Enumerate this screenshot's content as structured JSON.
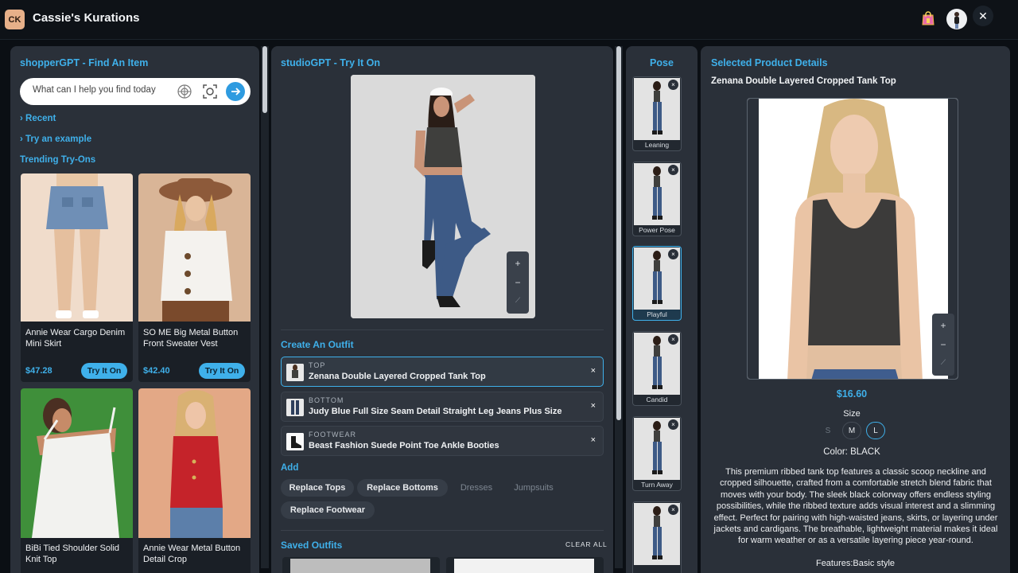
{
  "app": {
    "logo": "CK",
    "title": "Cassie's Kurations",
    "close": "✕"
  },
  "shopper": {
    "title": "shopperGPT - Find An Item",
    "search_placeholder": "What can I help you find today",
    "recent": "Recent",
    "example": "Try an example",
    "trending": "Trending Try-Ons",
    "products": [
      {
        "name": "Annie Wear Cargo Denim Mini Skirt",
        "price": "$47.28",
        "cta": "Try It On"
      },
      {
        "name": "SO ME Big Metal Button Front Sweater Vest",
        "price": "$42.40",
        "cta": "Try It On"
      },
      {
        "name": "BiBi Tied Shoulder Solid Knit Top",
        "price": "",
        "cta": ""
      },
      {
        "name": "Annie Wear Metal Button Detail Crop",
        "price": "",
        "cta": ""
      }
    ]
  },
  "studio": {
    "title": "studioGPT - Try It On",
    "zoom": {
      "plus": "+",
      "minus": "−",
      "edit": "⟋"
    },
    "create_title": "Create An Outfit",
    "outfit": [
      {
        "category": "TOP",
        "name": "Zenana Double Layered Cropped Tank Top"
      },
      {
        "category": "BOTTOM",
        "name": "Judy Blue Full Size Seam Detail Straight Leg Jeans Plus Size"
      },
      {
        "category": "FOOTWEAR",
        "name": "Beast Fashion Suede Point Toe Ankle Booties"
      }
    ],
    "remove": "×",
    "add_title": "Add",
    "chips": [
      "Replace Tops",
      "Replace Bottoms",
      "Dresses",
      "Jumpsuits",
      "Replace Footwear"
    ],
    "saved_title": "Saved Outfits",
    "clear_all": "CLEAR ALL"
  },
  "pose": {
    "title": "Pose",
    "items": [
      "Leaning",
      "Power Pose",
      "Playful",
      "Candid",
      "Turn Away",
      ""
    ],
    "selected": "Playful",
    "remove": "×"
  },
  "detail": {
    "title": "Selected Product Details",
    "product_name": "Zenana Double Layered Cropped Tank Top",
    "price": "$16.60",
    "size_label": "Size",
    "sizes": [
      "S",
      "M",
      "L"
    ],
    "selected_size": "L",
    "color": "Color: BLACK",
    "description": "This premium ribbed tank top features a classic scoop neckline and cropped silhouette, crafted from a comfortable stretch blend fabric that moves with your body. The sleek black colorway offers endless styling possibilities, while the ribbed texture adds visual interest and a slimming effect. Perfect for pairing with high-waisted jeans, skirts, or layering under jackets and cardigans. The breathable, lightweight material makes it ideal for warm weather or as a versatile layering piece year-round.",
    "features": "Features:Basic style"
  },
  "colors": {
    "accent": "#3fb0ea",
    "panel": "#2a3039",
    "background": "#0b0f14"
  }
}
